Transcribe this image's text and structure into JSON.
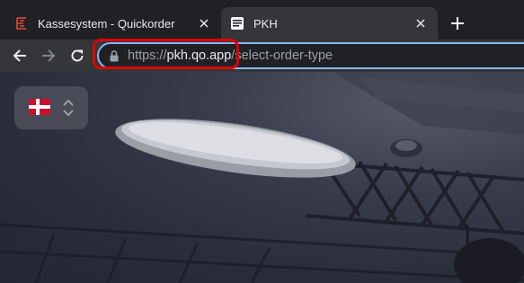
{
  "browser": {
    "tabs": [
      {
        "title": "Kassesystem - Quickorder",
        "favicon": "quickorder-logo-icon",
        "active": false
      },
      {
        "title": "PKH",
        "favicon": "pkh-logo-icon",
        "active": true
      }
    ],
    "new_tab_icon": "plus-icon",
    "nav": {
      "back_icon": "arrow-left-icon",
      "forward_icon": "arrow-right-icon",
      "reload_icon": "reload-icon"
    },
    "address": {
      "scheme": "https://",
      "host": "pkh.qo.app",
      "path": "/select-order-type",
      "lock_icon": "lock-icon"
    },
    "highlight_color": "#e00000"
  },
  "page": {
    "language_selector": {
      "flag": "denmark-flag",
      "icon": "chevron-up-down-icon"
    }
  }
}
